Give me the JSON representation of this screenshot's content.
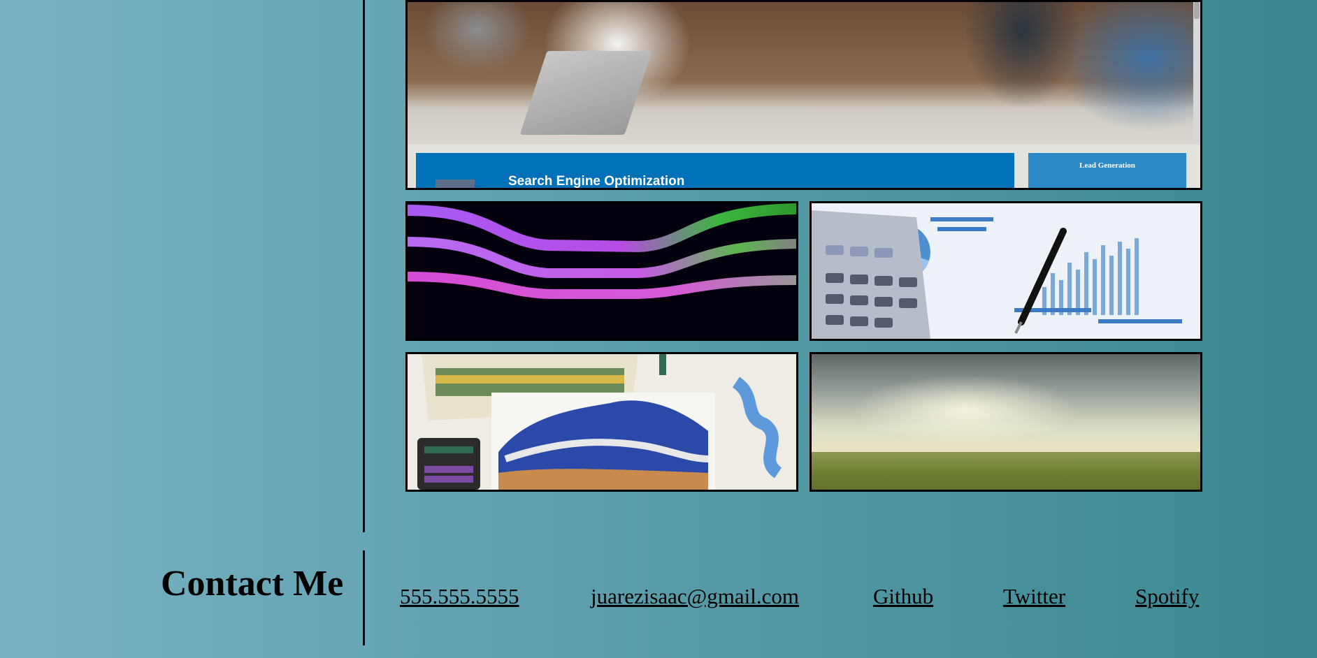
{
  "featured": {
    "seo_title": "Search Engine Optimization",
    "lead_title": "Lead Generation"
  },
  "contact": {
    "heading": "Contact Me",
    "links": [
      {
        "label": "555.555.5555"
      },
      {
        "label": "juarezisaac@gmail.com"
      },
      {
        "label": "Github"
      },
      {
        "label": "Twitter"
      },
      {
        "label": "Spotify"
      }
    ]
  }
}
